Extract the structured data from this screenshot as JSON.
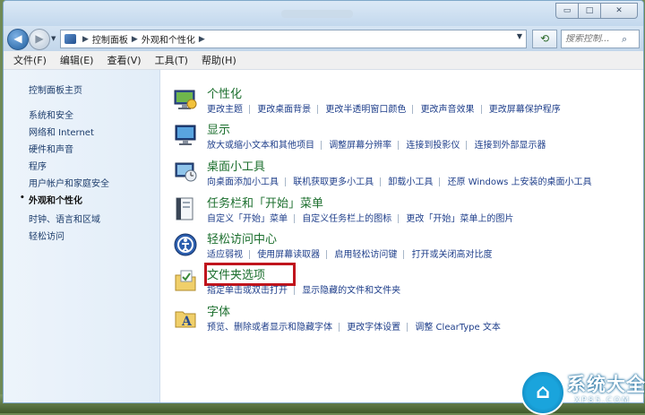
{
  "window": {
    "min_label": "▭",
    "max_label": "□",
    "close_label": "✕"
  },
  "nav": {
    "back_label": "◀",
    "forward_label": "▶",
    "recent_label": "▼",
    "breadcrumb": [
      "控制面板",
      "外观和个性化"
    ],
    "search_placeholder": "搜索控制..."
  },
  "menu": [
    "文件(F)",
    "编辑(E)",
    "查看(V)",
    "工具(T)",
    "帮助(H)"
  ],
  "sidebar": {
    "items": [
      {
        "label": "控制面板主页",
        "current": false
      },
      {
        "label": "系统和安全",
        "current": false
      },
      {
        "label": "网络和 Internet",
        "current": false
      },
      {
        "label": "硬件和声音",
        "current": false
      },
      {
        "label": "程序",
        "current": false
      },
      {
        "label": "用户帐户和家庭安全",
        "current": false
      },
      {
        "label": "外观和个性化",
        "current": true
      },
      {
        "label": "时钟、语言和区域",
        "current": false
      },
      {
        "label": "轻松访问",
        "current": false
      }
    ]
  },
  "categories": [
    {
      "title": "个性化",
      "icon": "personalization-icon",
      "links": [
        "更改主题",
        "更改桌面背景",
        "更改半透明窗口颜色",
        "更改声音效果",
        "更改屏幕保护程序"
      ]
    },
    {
      "title": "显示",
      "icon": "display-icon",
      "links": [
        "放大或缩小文本和其他项目",
        "调整屏幕分辨率",
        "连接到投影仪",
        "连接到外部显示器"
      ]
    },
    {
      "title": "桌面小工具",
      "icon": "gadgets-icon",
      "links": [
        "向桌面添加小工具",
        "联机获取更多小工具",
        "卸载小工具",
        "还原 Windows 上安装的桌面小工具"
      ]
    },
    {
      "title": "任务栏和「开始」菜单",
      "icon": "taskbar-icon",
      "links": [
        "自定义「开始」菜单",
        "自定义任务栏上的图标",
        "更改「开始」菜单上的图片"
      ]
    },
    {
      "title": "轻松访问中心",
      "icon": "ease-of-access-icon",
      "links": [
        "适应弱视",
        "使用屏幕读取器",
        "启用轻松访问键",
        "打开或关闭高对比度"
      ]
    },
    {
      "title": "文件夹选项",
      "icon": "folder-options-icon",
      "highlighted": true,
      "links": [
        "指定单击或双击打开",
        "显示隐藏的文件和文件夹"
      ]
    },
    {
      "title": "字体",
      "icon": "fonts-icon",
      "links": [
        "预览、删除或者显示和隐藏字体",
        "更改字体设置",
        "调整 ClearType 文本"
      ]
    }
  ],
  "watermark": {
    "logo_glyph": "⌂",
    "text": "系统大全",
    "url": "XP85.COM"
  },
  "colors": {
    "link": "#1e3e8a",
    "category_title": "#1c6f2e",
    "highlight_box": "#c0141c",
    "sidebar_bg": "#e8f1fa"
  }
}
